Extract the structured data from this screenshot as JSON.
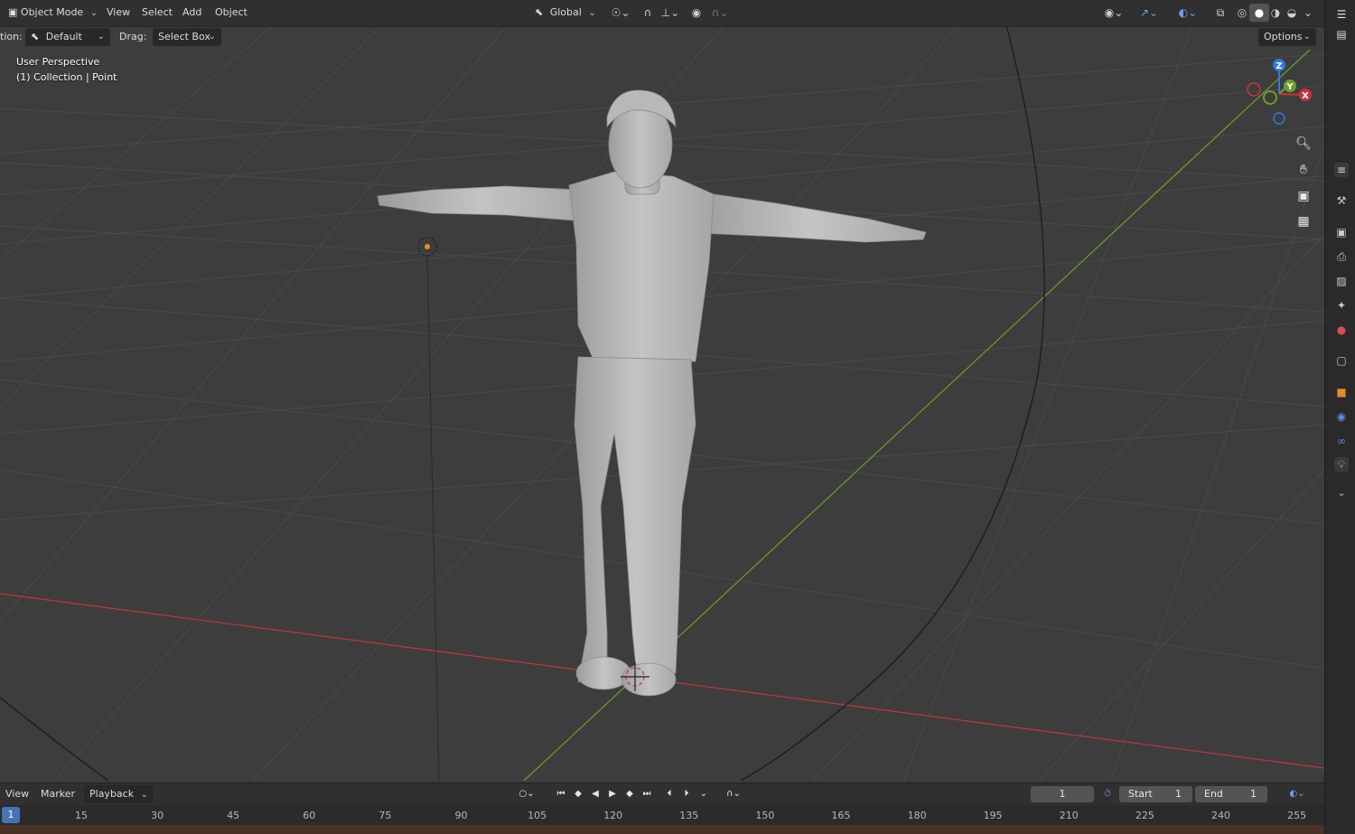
{
  "header": {
    "mode_label": "Object Mode",
    "menus": [
      "View",
      "Select",
      "Add",
      "Object"
    ],
    "transform_orientation": "Global"
  },
  "toolbar": {
    "orientation_label": "tion:",
    "orientation_value": "Default",
    "drag_label": "Drag:",
    "drag_value": "Select Box",
    "options_label": "Options"
  },
  "viewport": {
    "perspective": "User Perspective",
    "collection_info": "(1) Collection | Point",
    "gizmo_axes": {
      "z": "Z",
      "y": "Y",
      "x": "X"
    }
  },
  "timeline": {
    "menus": [
      "View",
      "Marker"
    ],
    "playback_label": "Playback",
    "current_frame": "1",
    "start_label": "Start",
    "start_value": "1",
    "end_label": "End",
    "end_value": "1",
    "ruler_current": "1",
    "ruler_ticks": [
      "15",
      "30",
      "45",
      "60",
      "75",
      "90",
      "105",
      "120",
      "135",
      "150",
      "165",
      "180",
      "195",
      "210",
      "225",
      "240",
      "255"
    ]
  },
  "colors": {
    "x_axis": "#c8323c",
    "y_axis": "#6aa02a",
    "z_axis": "#2f78e0",
    "accent": "#4772b3"
  }
}
